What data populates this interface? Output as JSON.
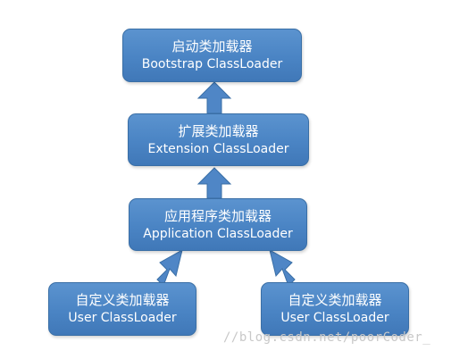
{
  "nodes": {
    "bootstrap": {
      "cn": "启动类加载器",
      "en": "Bootstrap ClassLoader"
    },
    "extension": {
      "cn": "扩展类加载器",
      "en": "Extension ClassLoader"
    },
    "application": {
      "cn": "应用程序类加载器",
      "en": "Application ClassLoader"
    },
    "user_left": {
      "cn": "自定义类加载器",
      "en": "User ClassLoader"
    },
    "user_right": {
      "cn": "自定义类加载器",
      "en": "User ClassLoader"
    }
  },
  "edges": [
    {
      "from": "extension",
      "to": "bootstrap"
    },
    {
      "from": "application",
      "to": "extension"
    },
    {
      "from": "user_left",
      "to": "application"
    },
    {
      "from": "user_right",
      "to": "application"
    }
  ],
  "colors": {
    "node_fill": "#4a84c4",
    "node_border": "#3a6fa6",
    "arrow_fill": "#4f86c6",
    "arrow_stroke": "#3a6fa6"
  },
  "watermark": "//blog.csdn.net/poorCoder_"
}
